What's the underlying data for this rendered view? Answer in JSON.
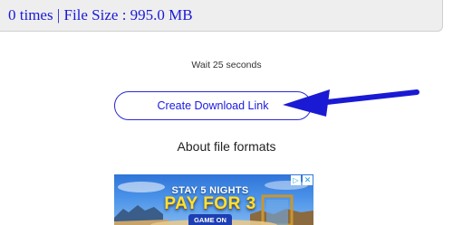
{
  "info_bar": {
    "text": "0 times | File Size : 995.0 MB"
  },
  "wait_text": "Wait 25 seconds",
  "download_button": {
    "label": "Create Download Link"
  },
  "about_link": "About file formats",
  "advertisement": {
    "line1": "STAY 5 NIGHTS",
    "line2": "PAY FOR 3",
    "cta": "GAME ON",
    "choices_icon": "adchoices-icon",
    "close_icon": "close-icon"
  },
  "colors": {
    "link_blue": "#1a1ad8",
    "arrow_blue": "#1a1ad4",
    "info_bar_bg": "#eeeeee",
    "ad_headline_yellow": "#ffe033"
  }
}
